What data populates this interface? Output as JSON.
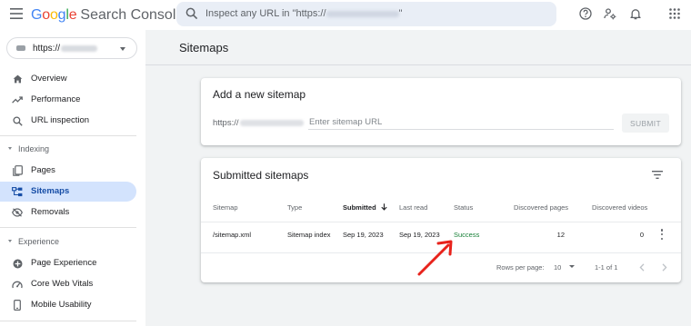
{
  "header": {
    "logo_text": "Google",
    "product_name": "Search Console",
    "search_placeholder": "Inspect any URL in \"https://",
    "search_placeholder_tail": "\""
  },
  "sidebar": {
    "property": "https://",
    "items": [
      {
        "label": "Overview",
        "icon": "home-icon"
      },
      {
        "label": "Performance",
        "icon": "trending-up-icon"
      },
      {
        "label": "URL inspection",
        "icon": "search-icon"
      }
    ],
    "sections": [
      {
        "label": "Indexing",
        "items": [
          {
            "label": "Pages",
            "icon": "pages-icon"
          },
          {
            "label": "Sitemaps",
            "icon": "sitemap-icon",
            "active": true
          },
          {
            "label": "Removals",
            "icon": "removals-icon"
          }
        ]
      },
      {
        "label": "Experience",
        "items": [
          {
            "label": "Page Experience",
            "icon": "page-experience-icon"
          },
          {
            "label": "Core Web Vitals",
            "icon": "speed-icon"
          },
          {
            "label": "Mobile Usability",
            "icon": "phone-icon"
          }
        ]
      }
    ]
  },
  "main": {
    "page_title": "Sitemaps",
    "add_card": {
      "title": "Add a new sitemap",
      "url_prefix": "https://",
      "input_placeholder": "Enter sitemap URL",
      "submit_label": "SUBMIT"
    },
    "submitted_card": {
      "title": "Submitted sitemaps",
      "columns": [
        "Sitemap",
        "Type",
        "Submitted",
        "Last read",
        "Status",
        "Discovered pages",
        "Discovered videos"
      ],
      "sorted_column": "Submitted",
      "rows": [
        {
          "sitemap": "/sitemap.xml",
          "type": "Sitemap index",
          "submitted": "Sep 19, 2023",
          "last_read": "Sep 19, 2023",
          "status": "Success",
          "discovered_pages": "12",
          "discovered_videos": "0"
        }
      ],
      "footer": {
        "rows_per_page_label": "Rows per page:",
        "rows_per_page_value": "10",
        "range": "1-1 of 1"
      }
    }
  },
  "colors": {
    "accent": "#1a73e8",
    "active_nav_bg": "#d3e3fd",
    "success": "#188038",
    "annotation_arrow": "#e8231c",
    "page_bg": "#f1f3f4"
  }
}
